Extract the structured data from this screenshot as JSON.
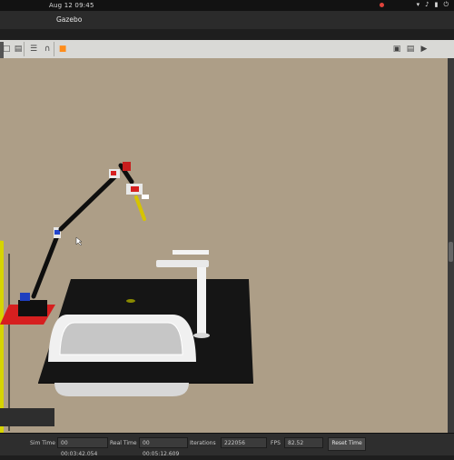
{
  "system_bar": {
    "clock": "Aug 12  09:45"
  },
  "window": {
    "title": "Gazebo"
  },
  "toolbar": {
    "tools": [
      "new-icon",
      "save-icon",
      "chart-icon",
      "headphones-icon",
      "robot-icon"
    ],
    "right_tools": [
      "camera-icon",
      "log-icon",
      "video-icon"
    ]
  },
  "status_bar": {
    "sim_time_label": "Sim Time",
    "sim_time_value": "00 00:03:42.054",
    "real_time_label": "Real Time",
    "real_time_value": "00 00:05:12.609",
    "iterations_label": "Iterations",
    "iterations_value": "222056",
    "fps_label": "FPS",
    "fps_value": "82.52",
    "reset_label": "Reset Time"
  },
  "colors": {
    "background": "#ad9e87",
    "countertop": "#151515",
    "sink": "#eeeeee",
    "pedestal_red": "#d62020"
  }
}
